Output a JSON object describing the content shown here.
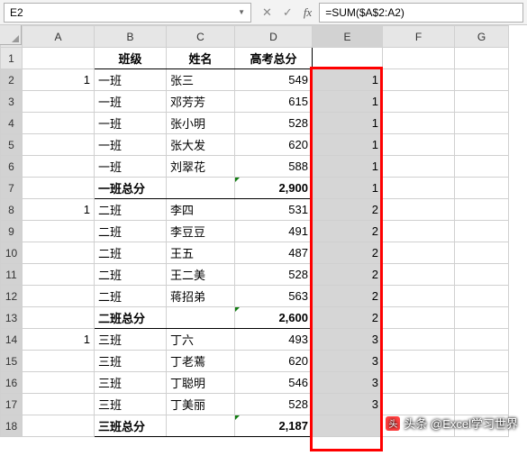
{
  "nameBox": "E2",
  "formula": "=SUM($A$2:A2)",
  "columns": [
    "A",
    "B",
    "C",
    "D",
    "E",
    "F",
    "G"
  ],
  "headerRow": {
    "B": "班级",
    "C": "姓名",
    "D": "高考总分"
  },
  "rows": [
    {
      "n": 1,
      "A": "",
      "B_hdr": true,
      "C_hdr": true,
      "D_hdr": true
    },
    {
      "n": 2,
      "A": "1",
      "B": "一班",
      "C": "张三",
      "D": "549",
      "E": "1"
    },
    {
      "n": 3,
      "A": "",
      "B": "一班",
      "C": "邓芳芳",
      "D": "615",
      "E": "1"
    },
    {
      "n": 4,
      "A": "",
      "B": "一班",
      "C": "张小明",
      "D": "528",
      "E": "1"
    },
    {
      "n": 5,
      "A": "",
      "B": "一班",
      "C": "张大发",
      "D": "620",
      "E": "1"
    },
    {
      "n": 6,
      "A": "",
      "B": "一班",
      "C": "刘翠花",
      "D": "588",
      "E": "1"
    },
    {
      "n": 7,
      "A": "",
      "Bsum": "一班总分",
      "Dsum": "2,900",
      "E": "1",
      "tri": true
    },
    {
      "n": 8,
      "A": "1",
      "B": "二班",
      "C": "李四",
      "D": "531",
      "E": "2"
    },
    {
      "n": 9,
      "A": "",
      "B": "二班",
      "C": "李豆豆",
      "D": "491",
      "E": "2"
    },
    {
      "n": 10,
      "A": "",
      "B": "二班",
      "C": "王五",
      "D": "487",
      "E": "2"
    },
    {
      "n": 11,
      "A": "",
      "B": "二班",
      "C": "王二美",
      "D": "528",
      "E": "2"
    },
    {
      "n": 12,
      "A": "",
      "B": "二班",
      "C": "蒋招弟",
      "D": "563",
      "E": "2"
    },
    {
      "n": 13,
      "A": "",
      "Bsum": "二班总分",
      "Dsum": "2,600",
      "E": "2",
      "tri": true
    },
    {
      "n": 14,
      "A": "1",
      "B": "三班",
      "C": "丁六",
      "D": "493",
      "E": "3"
    },
    {
      "n": 15,
      "A": "",
      "B": "三班",
      "C": "丁老蔫",
      "D": "620",
      "E": "3"
    },
    {
      "n": 16,
      "A": "",
      "B": "三班",
      "C": "丁聪明",
      "D": "546",
      "E": "3"
    },
    {
      "n": 17,
      "A": "",
      "B": "三班",
      "C": "丁美丽",
      "D": "528",
      "E": "3"
    },
    {
      "n": 18,
      "A": "",
      "Bsum": "三班总分",
      "Dsum": "2,187",
      "E": "",
      "tri": true
    }
  ],
  "watermark": "头条 @Excel学习世界",
  "chart_data": {
    "type": "table",
    "title": "高考总分",
    "columns": [
      "班级",
      "姓名",
      "高考总分"
    ],
    "records": [
      [
        "一班",
        "张三",
        549
      ],
      [
        "一班",
        "邓芳芳",
        615
      ],
      [
        "一班",
        "张小明",
        528
      ],
      [
        "一班",
        "张大发",
        620
      ],
      [
        "一班",
        "刘翠花",
        588
      ],
      [
        "二班",
        "李四",
        531
      ],
      [
        "二班",
        "李豆豆",
        491
      ],
      [
        "二班",
        "王五",
        487
      ],
      [
        "二班",
        "王二美",
        528
      ],
      [
        "二班",
        "蒋招弟",
        563
      ],
      [
        "三班",
        "丁六",
        493
      ],
      [
        "三班",
        "丁老蔫",
        620
      ],
      [
        "三班",
        "丁聪明",
        546
      ],
      [
        "三班",
        "丁美丽",
        528
      ]
    ],
    "subtotals": {
      "一班总分": 2900,
      "二班总分": 2600,
      "三班总分": 2187
    }
  }
}
